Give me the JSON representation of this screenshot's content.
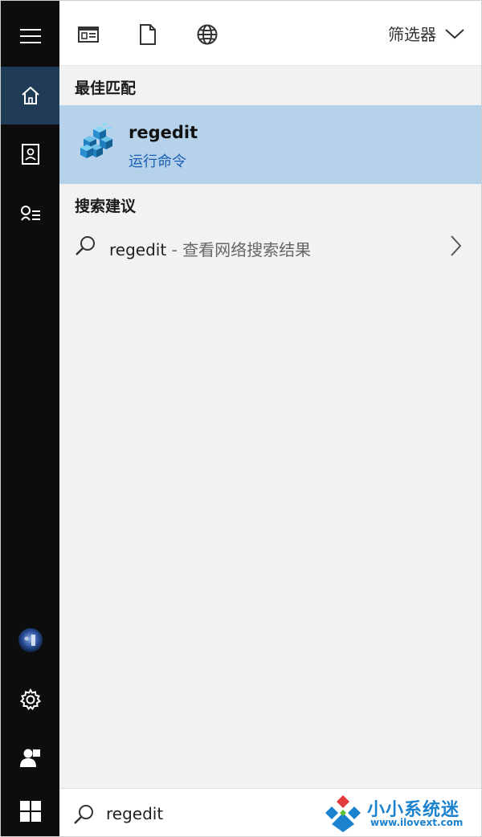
{
  "toolbar": {
    "filter_label": "筛选器"
  },
  "sections": {
    "best_match_label": "最佳匹配",
    "suggestions_label": "搜索建议"
  },
  "best_match": {
    "title": "regedit",
    "subtitle": "运行命令"
  },
  "suggestion": {
    "query": "regedit",
    "hint": " - 查看网络搜索结果"
  },
  "search": {
    "value": "regedit"
  },
  "watermark": {
    "name": "小小系统迷",
    "url": "www.ilovext.com"
  },
  "colors": {
    "rail_bg": "#0d0d0d",
    "rail_active": "#1f3b55",
    "best_match_bg": "#b6d2ea",
    "accent_text": "#1a5fb4"
  },
  "icons": {
    "menu": "hamburger-menu-icon",
    "home": "home-icon",
    "notebook": "notebook-icon",
    "feedback": "feedback-icon",
    "avatar": "avatar",
    "settings": "gear-icon",
    "account": "person-icon",
    "start": "windows-logo-icon",
    "apps_filter": "app-window-icon",
    "docs_filter": "document-icon",
    "web_filter": "globe-icon",
    "search": "search-icon"
  }
}
